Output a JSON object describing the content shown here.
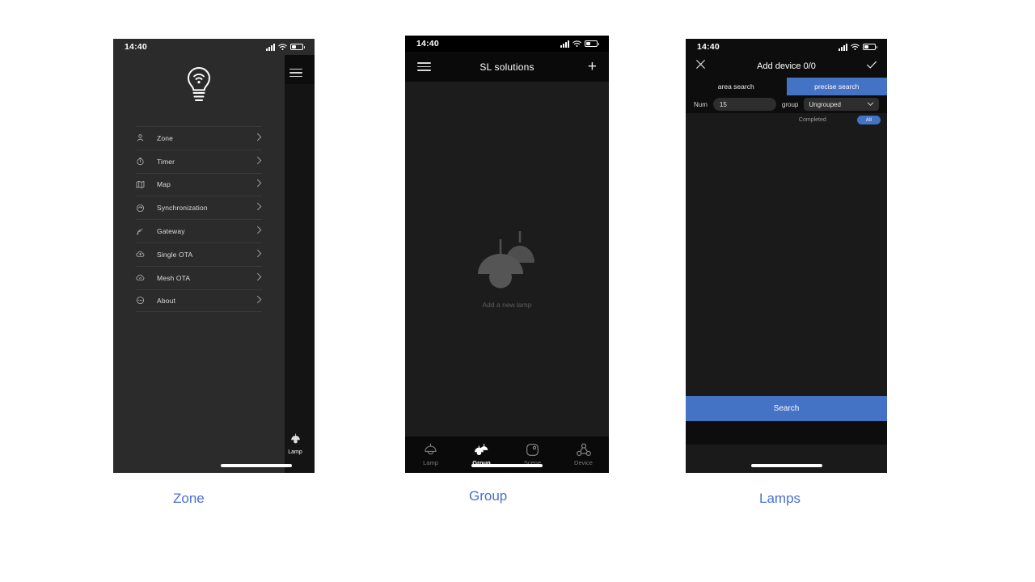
{
  "colors": {
    "accent_blue": "#4472c4",
    "caption_blue": "#4a6fd4",
    "drawer_bg": "#2b2b2b",
    "phone_bg": "#1a1a1a",
    "nav_bg": "#0d0d0d",
    "page_bg": "#ffffff"
  },
  "status_bar": {
    "time": "14:40",
    "signal_icon": "signal-bars-icon",
    "wifi_icon": "wifi-icon",
    "battery_icon": "battery-icon"
  },
  "phone1": {
    "caption": "Zone",
    "logo_icon": "smart-bulb-logo-icon",
    "menu": [
      {
        "label": "Zone",
        "icon": "location-pin-icon",
        "chevron": "chevron-right-icon"
      },
      {
        "label": "Timer",
        "icon": "stopwatch-icon",
        "chevron": "chevron-right-icon"
      },
      {
        "label": "Map",
        "icon": "map-icon",
        "chevron": "chevron-right-icon"
      },
      {
        "label": "Synchronization",
        "icon": "sync-cloud-icon",
        "chevron": "chevron-right-icon"
      },
      {
        "label": "Gateway",
        "icon": "signal-waves-icon",
        "chevron": "chevron-right-icon"
      },
      {
        "label": "Single OTA",
        "icon": "cloud-upload-icon",
        "chevron": "chevron-right-icon"
      },
      {
        "label": "Mesh OTA",
        "icon": "cloud-mesh-icon",
        "chevron": "chevron-right-icon"
      },
      {
        "label": "About",
        "icon": "info-dots-icon",
        "chevron": "chevron-right-icon"
      }
    ],
    "behind": {
      "menu_icon": "hamburger-menu-icon",
      "tab_label": "Lamp",
      "tab_icon": "pendant-lamp-icon"
    }
  },
  "phone2": {
    "caption": "Group",
    "nav": {
      "menu_icon": "hamburger-menu-icon",
      "title": "SL solutions",
      "add_icon": "plus-icon"
    },
    "empty_state": {
      "illustration_icon": "two-pendant-lamps-icon",
      "text": "Add a new lamp"
    },
    "tabs": [
      {
        "label": "Lamp",
        "icon": "pendant-lamp-icon",
        "active": false
      },
      {
        "label": "Group",
        "icon": "lamp-group-icon",
        "active": true
      },
      {
        "label": "Scene",
        "icon": "scene-square-icon",
        "active": false
      },
      {
        "label": "Device",
        "icon": "device-nodes-icon",
        "active": false
      }
    ]
  },
  "phone3": {
    "caption": "Lamps",
    "nav": {
      "close_icon": "close-x-icon",
      "title": "Add device 0/0",
      "confirm_icon": "checkmark-icon"
    },
    "segments": [
      {
        "label": "area search",
        "active": false
      },
      {
        "label": "precise search",
        "active": true
      }
    ],
    "form": {
      "num_label": "Num",
      "num_value": "15",
      "num_placeholder": "15",
      "group_label": "group",
      "group_value": "Ungrouped",
      "dropdown_icon": "chevron-down-icon"
    },
    "status": {
      "completed_label": "Completed",
      "all_badge": "All"
    },
    "search_button": "Search"
  }
}
